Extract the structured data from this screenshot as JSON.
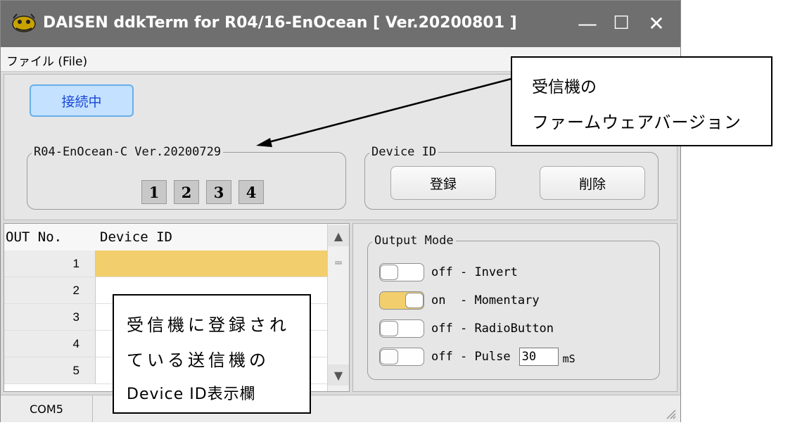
{
  "window": {
    "title": "DAISEN ddkTerm for R04/16-EnOcean [ Ver.20200801 ]",
    "minimize_symbol": "—",
    "maximize_symbol": "☐",
    "close_symbol": "✕"
  },
  "menu": {
    "file": "ファイル (File)"
  },
  "connection": {
    "label": "接続中",
    "color": "#c4e2ff"
  },
  "firmware": {
    "legend": "R04-EnOcean-C Ver.20200729",
    "channels": [
      "1",
      "2",
      "3",
      "4"
    ]
  },
  "device_id": {
    "legend": "Device ID",
    "register_label": "登録",
    "delete_label": "削除"
  },
  "table": {
    "col_out": "OUT No.",
    "col_device": "Device ID",
    "rows": [
      {
        "no": "1",
        "device_id": ""
      },
      {
        "no": "2",
        "device_id": ""
      },
      {
        "no": "3",
        "device_id": ""
      },
      {
        "no": "4",
        "device_id": ""
      },
      {
        "no": "5",
        "device_id": ""
      }
    ],
    "selected_row_color": "#f2cf6c"
  },
  "output_mode": {
    "legend": "Output Mode",
    "modes": [
      {
        "state": "off",
        "label": "- Invert"
      },
      {
        "state": "on",
        "label": "- Momentary"
      },
      {
        "state": "off",
        "label": "- RadioButton"
      },
      {
        "state": "off",
        "label": "- Pulse"
      }
    ],
    "pulse_value": "30",
    "pulse_unit": "mS"
  },
  "status": {
    "port": "COM5"
  },
  "annotations": {
    "firmware_callout": {
      "line1": "受信機の",
      "line2": "ファームウェアバージョン"
    },
    "table_callout": {
      "line1": "受信機に登録され",
      "line2": "ている送信機の",
      "line3": "Device ID表示欄"
    }
  }
}
